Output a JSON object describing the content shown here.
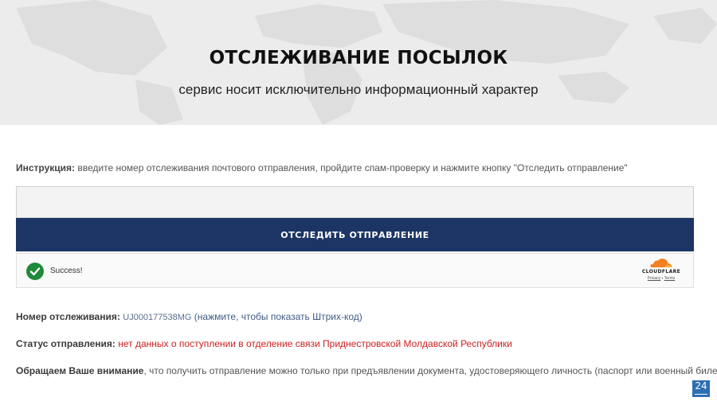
{
  "hero": {
    "title": "ОТСЛЕЖИВАНИЕ ПОСЫЛОК",
    "subtitle": "сервис носит исключительно информационный характер",
    "background_icon": "world-map-icon"
  },
  "instruction": {
    "label": "Инструкция:",
    "text": " введите номер отслеживания почтового отправления, пройдите спам-проверку и нажмите кнопку \"Отследить отправление\""
  },
  "form": {
    "input_value": "",
    "button_label": "ОТСЛЕДИТЬ ОТПРАВЛЕНИЕ"
  },
  "captcha": {
    "status_text": "Success!",
    "status_icon": "check-circle-icon",
    "provider": "CLOUDFLARE",
    "privacy_link": "Privacy",
    "separator": "•",
    "terms_link": "Terms",
    "success_color": "#1f8a3a",
    "cloudflare_color": "#f38020"
  },
  "result": {
    "tracking_label": "Номер отслеживания:",
    "tracking_number": "UJ000177538MG",
    "barcode_link": "(нажмите, чтобы показать Штрих-код)",
    "status_label": "Статус отправления:",
    "status_value": "нет данных о поступлении в отделение связи Приднестровской Молдавской Республики",
    "notice_label": "Обращаем Ваше внимание",
    "notice_text": ", что получить отправление можно только при предъявлении документа, удостоверяющего личность (паспорт или военный билет)"
  },
  "badge": {
    "text": "24",
    "color": "#2d6fb2"
  },
  "colors": {
    "button_bg": "#1c3564",
    "status_red": "#cc1f1f",
    "link_blue": "#3f5b86",
    "hero_bg": "#ececec"
  }
}
